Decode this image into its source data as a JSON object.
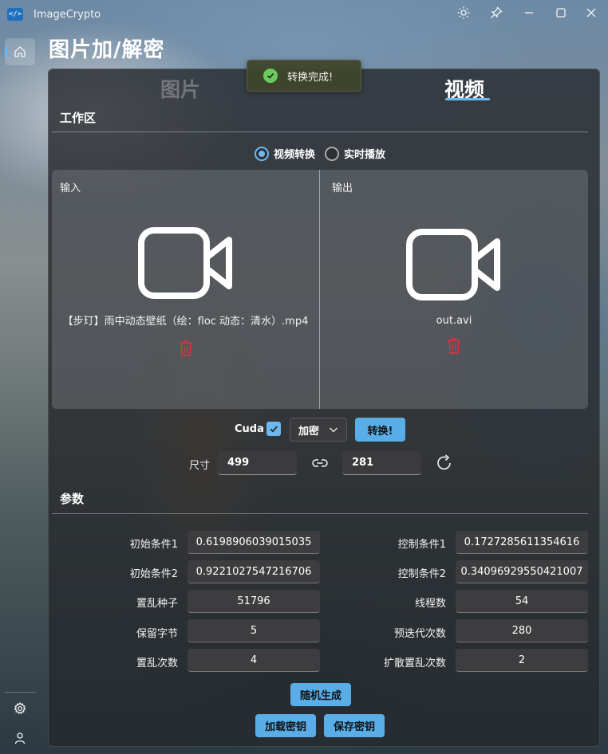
{
  "app": {
    "title": "ImageCrypto",
    "logo_glyph": "</>"
  },
  "page": {
    "title": "图片加/解密"
  },
  "tabs": [
    {
      "label": "图片"
    },
    {
      "label": "视频"
    }
  ],
  "toast": {
    "message": "转换完成!"
  },
  "workspace": {
    "label": "工作区",
    "modes": [
      {
        "label": "视频转换",
        "selected": true
      },
      {
        "label": "实时播放",
        "selected": false
      }
    ],
    "input": {
      "label": "输入",
      "file": "【步玎】雨中动态壁纸（绘：floc 动态：清水）.mp4"
    },
    "output": {
      "label": "输出",
      "file": "out.avi"
    }
  },
  "controls": {
    "cuda_label": "Cuda",
    "cuda_checked": true,
    "mode_select": "加密",
    "convert_button": "转换!",
    "size_label": "尺寸",
    "width": "499",
    "height": "281"
  },
  "params": {
    "label": "参数",
    "left": [
      {
        "label": "初始条件1",
        "value": "0.6198906039015035"
      },
      {
        "label": "初始条件2",
        "value": "0.9221027547216706"
      },
      {
        "label": "置乱种子",
        "value": "51796"
      },
      {
        "label": "保留字节",
        "value": "5"
      },
      {
        "label": "置乱次数",
        "value": "4"
      }
    ],
    "right": [
      {
        "label": "控制条件1",
        "value": "0.1727285611354616"
      },
      {
        "label": "控制条件2",
        "value": "0.34096929550421007"
      },
      {
        "label": "线程数",
        "value": "54"
      },
      {
        "label": "预迭代次数",
        "value": "280"
      },
      {
        "label": "扩散置乱次数",
        "value": "2"
      }
    ],
    "random_button": "随机生成",
    "load_key_button": "加载密钥",
    "save_key_button": "保存密钥"
  },
  "colors": {
    "accent": "#6cb8f0",
    "button": "#5aaee8",
    "delete": "#d9363e",
    "success": "#6ccb5f"
  }
}
